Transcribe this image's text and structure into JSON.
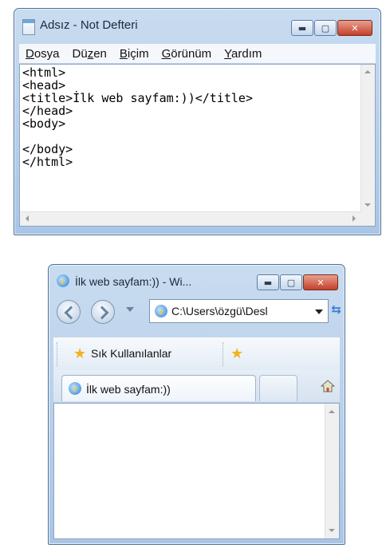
{
  "notepad": {
    "title": "Adsız - Not Defteri",
    "menu": {
      "file": {
        "mnemonic": "D",
        "rest": "osya"
      },
      "edit": {
        "pre": "Dü",
        "mnemonic": "z",
        "rest": "en"
      },
      "format": {
        "mnemonic": "B",
        "rest": "içim"
      },
      "view": {
        "mnemonic": "G",
        "rest": "örünüm"
      },
      "help": {
        "mnemonic": "Y",
        "rest": "ardım"
      }
    },
    "content": "<html>\n<head>\n<title>İlk web sayfam:))</title>\n</head>\n<body>\n\n</body>\n</html>",
    "icon": "notepad-icon"
  },
  "browser": {
    "title": "İlk web sayfam:)) - Wi...",
    "address": "C:\\Users\\özgü\\Desl",
    "favorites_label": "Sık Kullanılanlar",
    "tab_label": "İlk web sayfam:))",
    "icons": [
      "ie-logo-icon",
      "back-icon",
      "forward-icon",
      "refresh-icon",
      "favorites-star-icon",
      "add-favorites-icon",
      "home-icon"
    ]
  },
  "caption_buttons": {
    "minimize": "▬",
    "maximize": "▢",
    "close": "✕"
  },
  "colors": {
    "titlebar": "#bcd3ec",
    "close": "#c4402a",
    "accent": "#2a7fd4"
  }
}
